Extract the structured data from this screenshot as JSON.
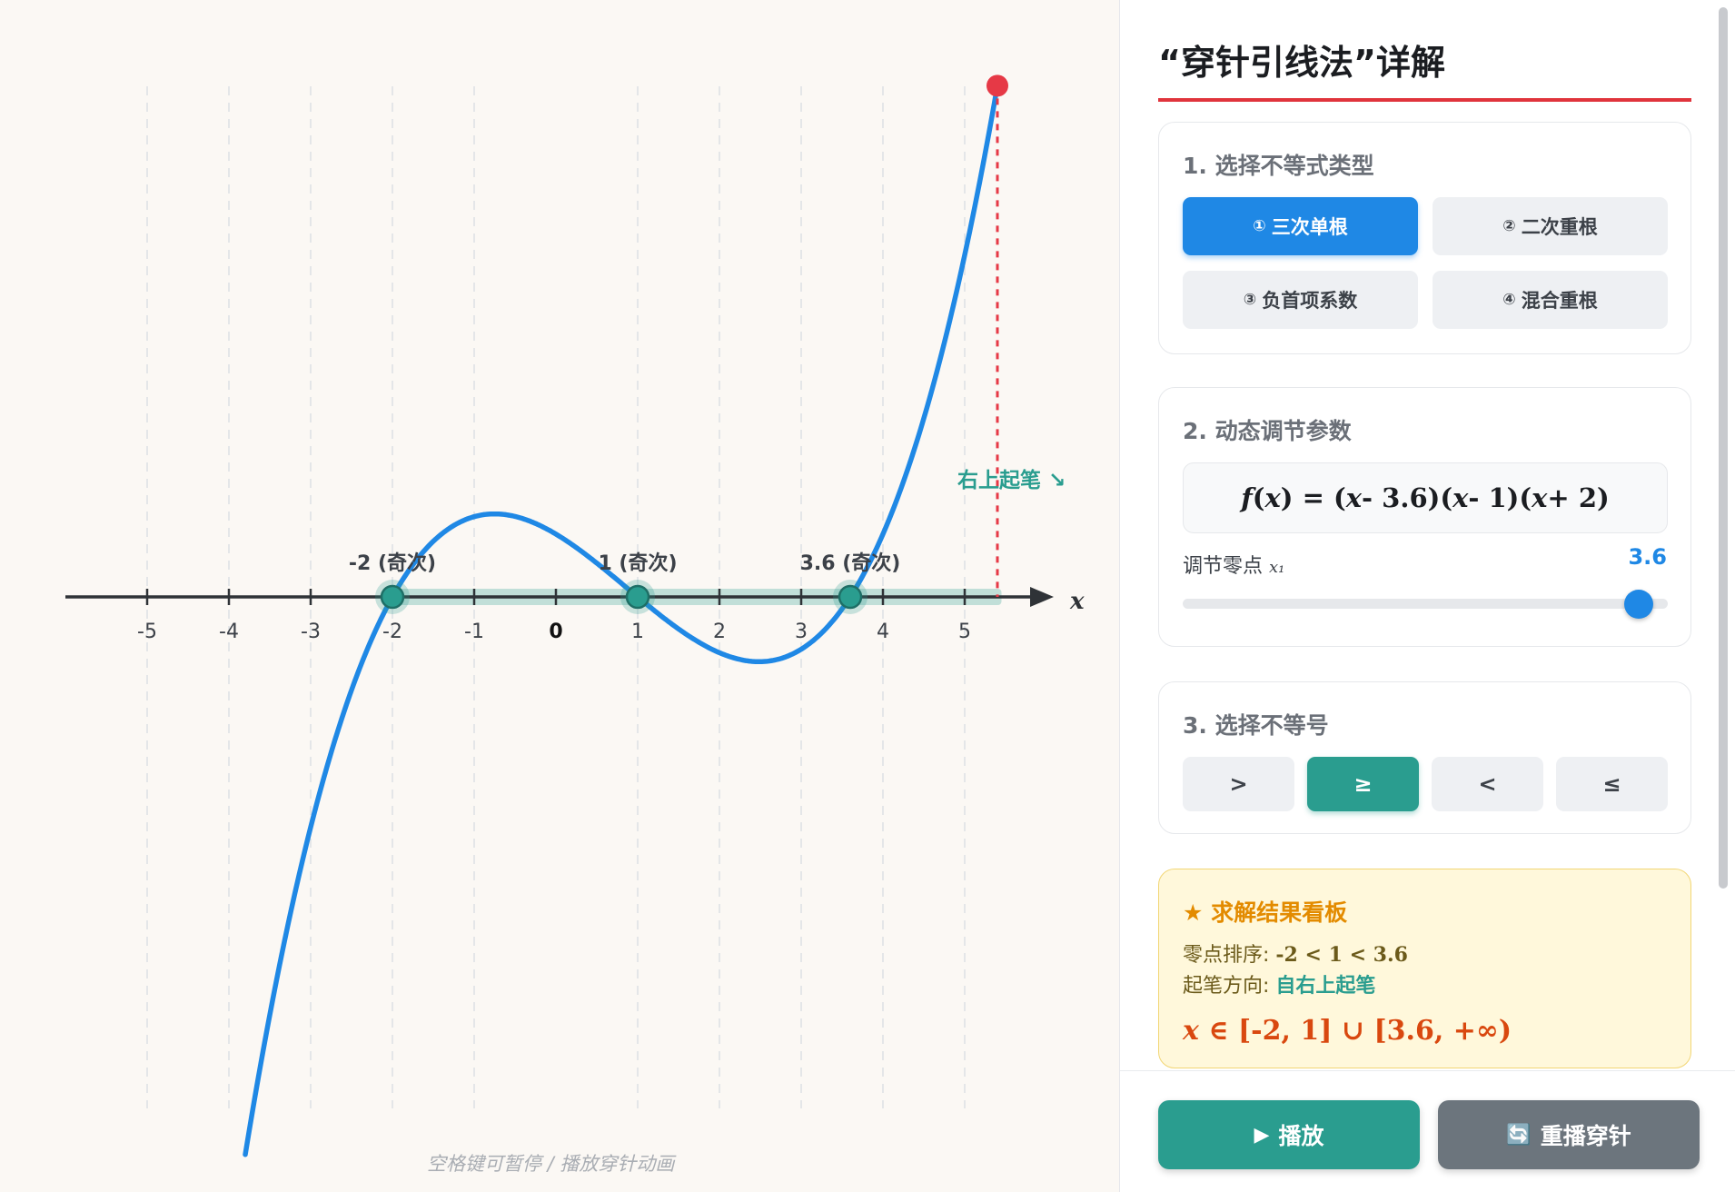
{
  "canvas": {
    "hint": "空格键可暂停 / 播放穿针动画",
    "axis_variable": "x",
    "ticks": [
      "-5",
      "-4",
      "-3",
      "-2",
      "-1",
      "0",
      "1",
      "2",
      "3",
      "4",
      "5"
    ],
    "roots": [
      {
        "value": -2,
        "label": "-2 (奇次)"
      },
      {
        "value": 1,
        "label": "1 (奇次)"
      },
      {
        "value": 3.6,
        "label": "3.6 (奇次)"
      }
    ],
    "start_label": "右上起笔 ↘",
    "colors": {
      "curve": "#1f88e5",
      "root": "#2a9d8f",
      "marker": "#e63946",
      "axis": "#2f3337"
    }
  },
  "panel": {
    "title": "“穿针引线法”详解",
    "section1": {
      "title": "1. 选择不等式类型",
      "options": [
        {
          "num": "①",
          "label": "三次单根",
          "active": true
        },
        {
          "num": "②",
          "label": "二次重根",
          "active": false
        },
        {
          "num": "③",
          "label": "负首项系数",
          "active": false
        },
        {
          "num": "④",
          "label": "混合重根",
          "active": false
        }
      ]
    },
    "section2": {
      "title": "2. 动态调节参数",
      "formula": {
        "f": "f",
        "x": "x",
        "eq": ") = (",
        "t1": " - 3.6)(",
        "t2": " - 1)(",
        "t3": " + 2)"
      },
      "param_label": "调节零点 ",
      "param_var": "x₁",
      "param_value": "3.6",
      "slider_fraction": 0.94
    },
    "section3": {
      "title": "3. 选择不等号",
      "signs": [
        {
          "label": ">",
          "active": false
        },
        {
          "label": "≥",
          "active": true
        },
        {
          "label": "<",
          "active": false
        },
        {
          "label": "≤",
          "active": false
        }
      ]
    },
    "result": {
      "title": "求解结果看板",
      "order_label": "零点排序: ",
      "order_value": "-2 < 1 < 3.6",
      "direction_label": "起笔方向: ",
      "direction_value": "自右上起笔",
      "answer_var": "x",
      "answer_rest": " ∈ [-2, 1] ∪ [3.6, +∞)"
    },
    "footer": {
      "play_icon": "▶",
      "play_label": "播放",
      "replay_icon": "🔄",
      "replay_label": "重播穿针"
    }
  }
}
